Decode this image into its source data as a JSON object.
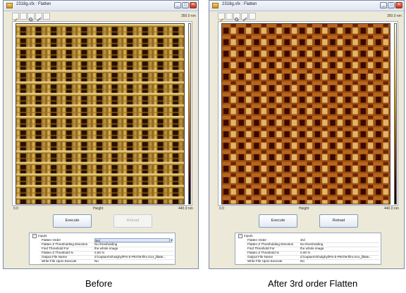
{
  "windows": [
    {
      "title": "2318g.sfx : Flatten",
      "top_value": "350.0 nm",
      "axis_left": "0.0",
      "axis_center": "Height",
      "axis_right": "440.0 nm",
      "execute_label": "Execute",
      "reload_label": "Reload",
      "reload_disabled": true,
      "group_label": "Inputs",
      "props": [
        {
          "key": "Flatten Order",
          "value": "3rd"
        },
        {
          "key": "Flatten Z Thresholding Direction",
          "value": "No thresholding"
        },
        {
          "key": "Find Threshold For",
          "value": "the whole image"
        },
        {
          "key": "Flatten Z Threshold %",
          "value": "0.00 %"
        },
        {
          "key": "Output File Name",
          "value": "d:\\capture\\Ghulghyl\\PS-b-PEO\\9-film.014_jflatte..."
        },
        {
          "key": "Write File Upon Execute",
          "value": "No"
        }
      ],
      "caption": "Before"
    },
    {
      "title": "2318g.sfx : Flatten",
      "top_value": "350.0 nm",
      "axis_left": "0.0",
      "axis_center": "Height",
      "axis_right": "440.0 nm",
      "execute_label": "Execute",
      "reload_label": "Reload",
      "reload_disabled": false,
      "group_label": "Inputs",
      "props": [
        {
          "key": "Flatten Order",
          "value": "3rd"
        },
        {
          "key": "Flatten Z Thresholding Direction",
          "value": "No thresholding"
        },
        {
          "key": "Find Threshold For",
          "value": "the whole image"
        },
        {
          "key": "Flatten Z Threshold %",
          "value": "0.00 %"
        },
        {
          "key": "Output File Name",
          "value": "d:\\capture\\Ghulghyl\\PS-b-PEO\\9-film.014_jflatte..."
        },
        {
          "key": "Write File Upon Execute",
          "value": "No"
        }
      ],
      "caption": "After 3rd order Flatten"
    }
  ],
  "toolbar_icons": [
    "pencil-icon",
    "select-icon",
    "zoom-icon",
    "measure-icon",
    "grid-icon"
  ],
  "colors": {
    "before_bright": "#f3cf6a",
    "before_mid": "#b47a18",
    "after_light": "#e3b466",
    "after_mid": "#9c4e10",
    "after_dark": "#3a0a00"
  }
}
